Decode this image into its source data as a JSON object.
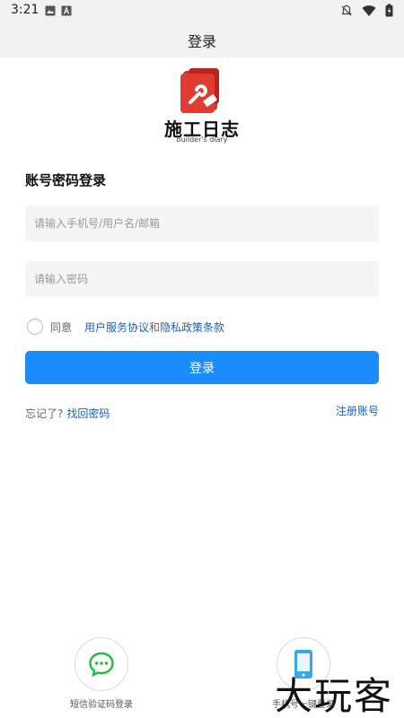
{
  "status_bar": {
    "time": "3:21",
    "left_icons": [
      "image-icon",
      "text-a-icon"
    ],
    "right_icons": [
      "bell-off-icon",
      "wifi-icon",
      "battery-icon"
    ]
  },
  "header": {
    "title": "登录"
  },
  "logo": {
    "name": "施工日志",
    "sub": "builder's diary",
    "color": "#d9342b"
  },
  "form": {
    "section_title": "账号密码登录",
    "username_placeholder": "请输入手机号/用户名/邮箱",
    "password_placeholder": "请输入密码",
    "agree_label": "同意",
    "agreement_link": "用户服务协议",
    "agree_sep": "和",
    "privacy_link": "隐私政策条款",
    "login_button": "登录",
    "forgot_prefix": "忘记了?",
    "forgot_link": "找回密码",
    "register_link": "注册账号"
  },
  "alt_login": [
    {
      "label": "短信验证码登录",
      "icon": "chat-bubble-icon",
      "color": "#1bbf3a"
    },
    {
      "label": "手机号一键登录",
      "icon": "phone-icon",
      "color": "#38a8e6"
    }
  ],
  "watermark": {
    "text": "大玩客"
  },
  "colors": {
    "accent": "#1a8cff",
    "link": "#1f5fb8",
    "input_bg": "#f5f5f5"
  }
}
